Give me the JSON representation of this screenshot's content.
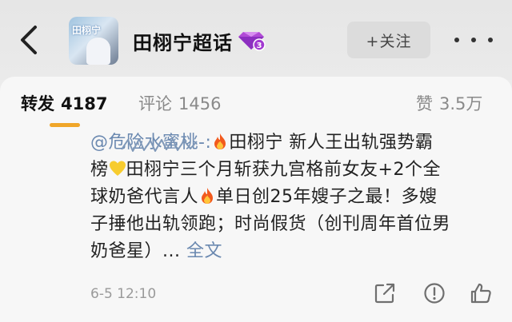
{
  "header": {
    "title": "田栩宁超话",
    "avatar_text": "田栩宁",
    "follow_label": "+关注",
    "badge_level": "3"
  },
  "tabs": [
    {
      "label": "转发",
      "count": "4187"
    },
    {
      "label": "评论",
      "count": "1456"
    },
    {
      "label": "赞",
      "count": "3.5万"
    }
  ],
  "post": {
    "mention": "@危险水蜜桃-:",
    "lines": [
      "田栩宁 新人王出轨强势霸",
      "榜",
      "田栩宁三个月斩获九宫格前女友+2个全",
      "球奶爸代言人",
      "单日创25年嫂子之最！多嫂",
      "子捶他出轨领跑；时尚假货（创刊周年首位男",
      "奶爸星）... ",
      "全文"
    ],
    "timestamp": "6-5 12:10"
  },
  "icons": {
    "back": "chevron-left-icon",
    "more": "more-dots-icon",
    "fire": "fire-emoji",
    "heart": "yellow-heart-emoji",
    "share": "share-icon",
    "report": "report-icon",
    "like": "thumbs-up-icon"
  },
  "colors": {
    "accent": "#f0a629",
    "link": "#6b89b0",
    "badge": "#b14bd6"
  }
}
